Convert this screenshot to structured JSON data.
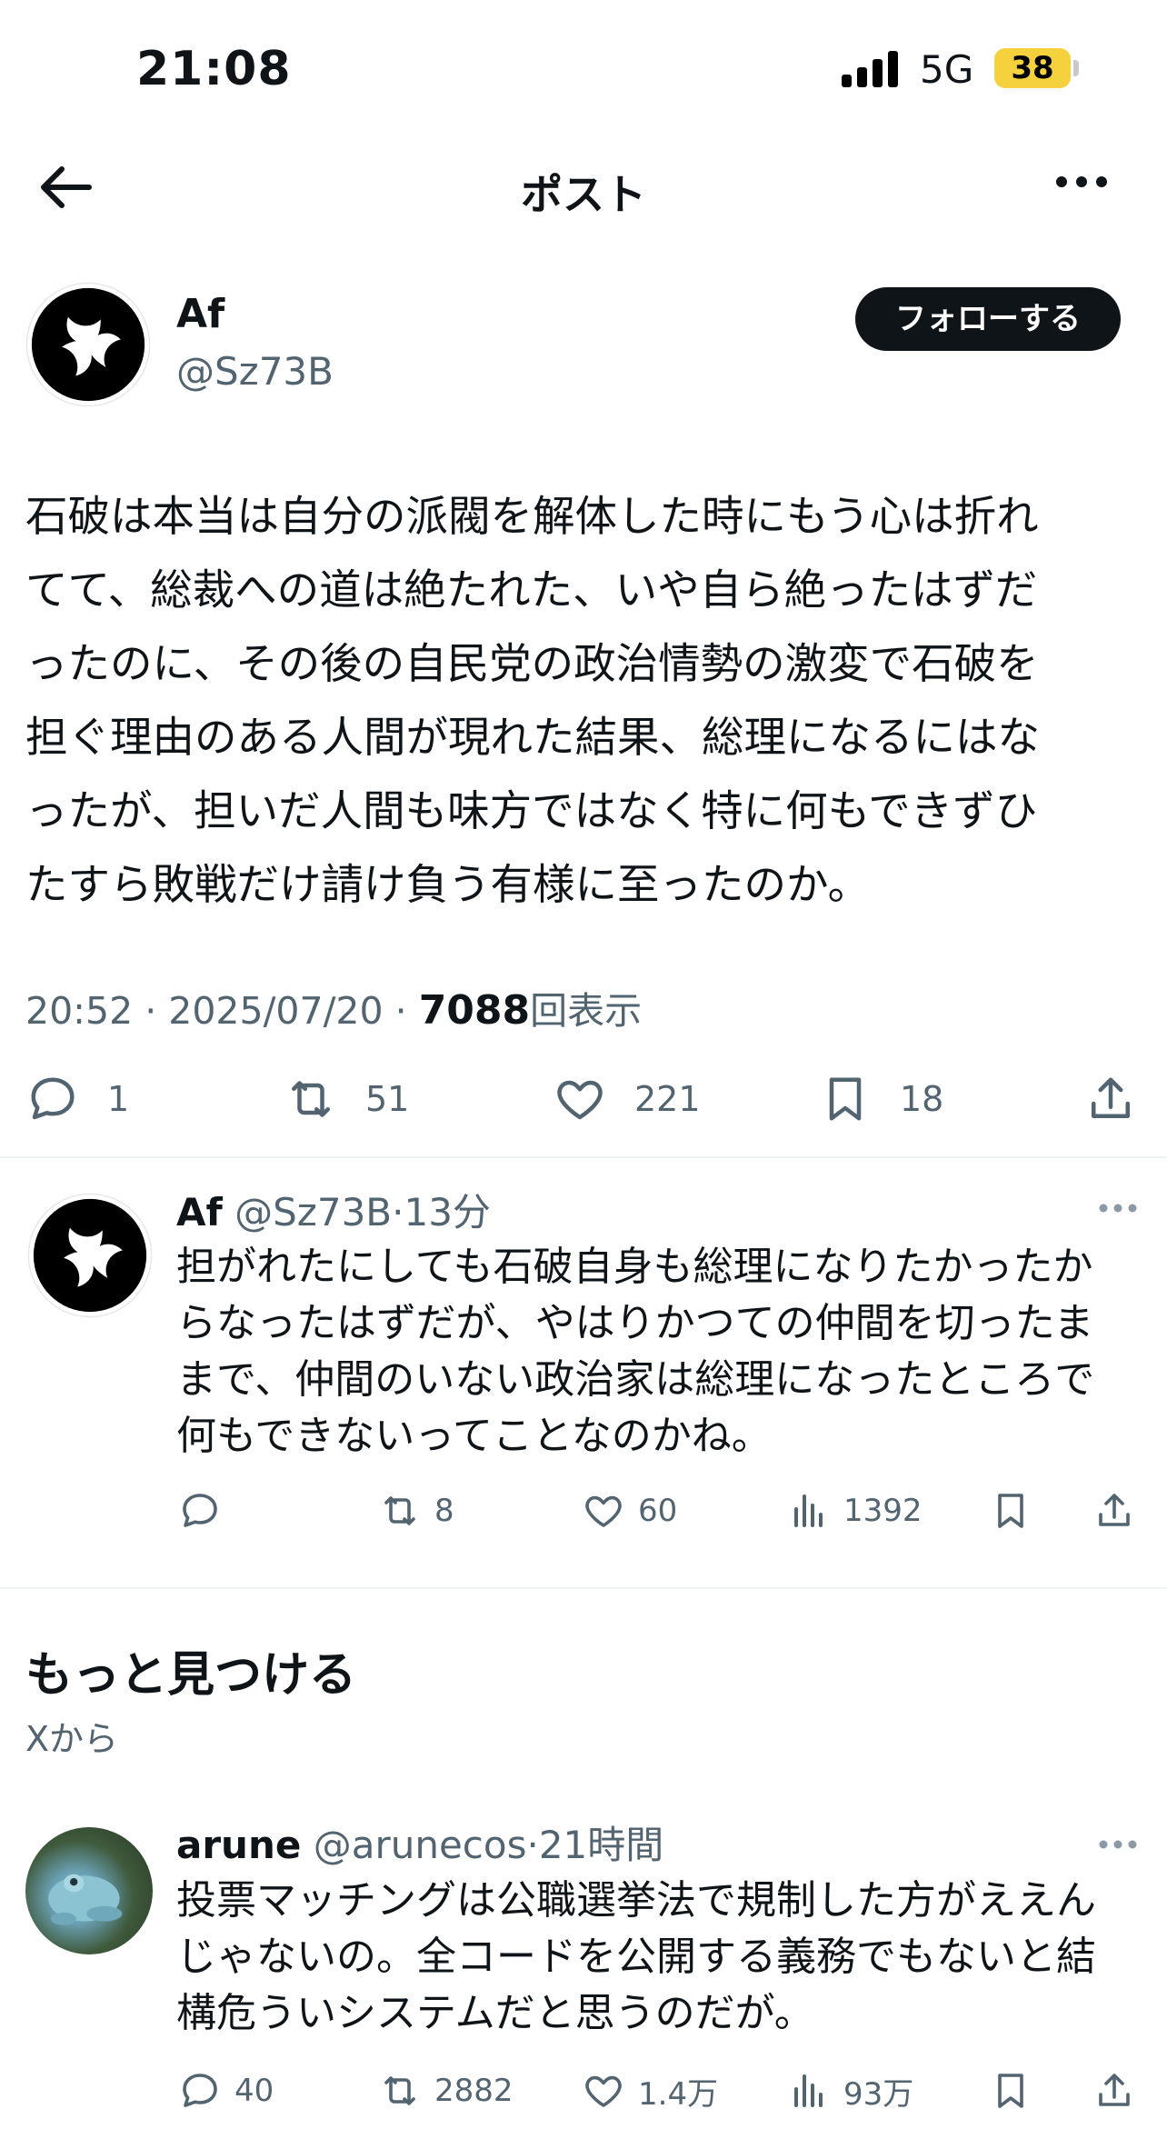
{
  "status_bar": {
    "time": "21:08",
    "network": "5G",
    "battery": "38"
  },
  "nav": {
    "title": "ポスト"
  },
  "post": {
    "name": "Af",
    "handle": "@Sz73B",
    "follow_label": "フォローする",
    "text_lines": [
      "石破は本当は自分の派閥を解体した時にもう心は折れ",
      "てて、総裁への道は絶たれた、いや自ら絶ったはずだ",
      "ったのに、その後の自民党の政治情勢の激変で石破を",
      "担ぐ理由のある人間が現れた結果、総理になるにはな",
      "ったが、担いだ人間も味方ではなく特に何もできずひ",
      "たすら敗戦だけ請け負う有様に至ったのか。"
    ],
    "time": "20:52",
    "date": "2025/07/20",
    "views": "7088",
    "views_suffix": "回表示",
    "replies": "1",
    "reposts": "51",
    "likes": "221",
    "bookmarks": "18"
  },
  "reply": {
    "name": "Af",
    "handle": "@Sz73B",
    "age": "13分",
    "text_lines": [
      "担がれたにしても石破自身も総理になりたかったか",
      "らなったはずだが、やはりかつての仲間を切ったま",
      "まで、仲間のいない政治家は総理になったところで",
      "何もできないってことなのかね。"
    ],
    "reposts": "8",
    "likes": "60",
    "views": "1392"
  },
  "discover": {
    "title": "もっと見つける",
    "subtitle": "Xから"
  },
  "suggested": {
    "name": "arune",
    "handle": "@arunecos",
    "age": "21時間",
    "text_lines": [
      "投票マッチングは公職選挙法で規制した方がええん",
      "じゃないの。全コードを公開する義務でもないと結",
      "構危ういシステムだと思うのだが。"
    ],
    "replies": "40",
    "reposts": "2882",
    "likes": "1.4万",
    "views": "93万"
  },
  "colors": {
    "text": "#0f1419",
    "secondary": "#536471",
    "battery": "#f5d23d",
    "divider": "#eff3f4"
  },
  "icons": [
    "back-arrow-icon",
    "more-icon",
    "reply-icon",
    "repost-icon",
    "like-icon",
    "bookmark-icon",
    "share-icon",
    "views-icon"
  ]
}
